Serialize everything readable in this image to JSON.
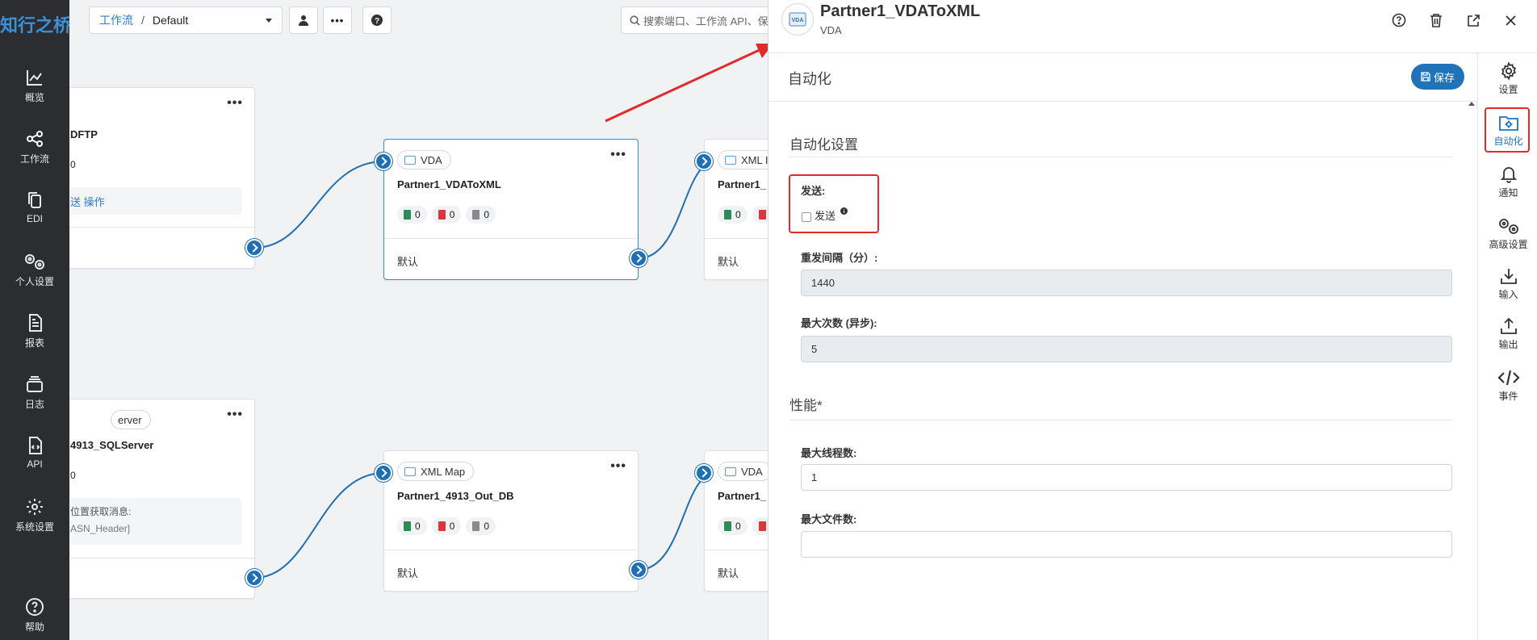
{
  "sidebar": {
    "logo": "知行之桥",
    "items": [
      {
        "label": "概览",
        "icon": "chart-icon"
      },
      {
        "label": "工作流",
        "icon": "flow-icon"
      },
      {
        "label": "EDI",
        "icon": "copy-icon"
      },
      {
        "label": "个人设置",
        "icon": "gears-icon"
      },
      {
        "label": "报表",
        "icon": "report-icon"
      },
      {
        "label": "日志",
        "icon": "layers-icon"
      },
      {
        "label": "API",
        "icon": "api-file-icon"
      },
      {
        "label": "系统设置",
        "icon": "gear-icon"
      }
    ],
    "help": "帮助"
  },
  "toolbar": {
    "breadcrumb_link": "工作流",
    "breadcrumb_sep": "/",
    "breadcrumb_current": "Default",
    "search_placeholder": "搜索端口、工作流 API、保"
  },
  "nodes": [
    {
      "tag": "",
      "title": "DFTP",
      "count": "0",
      "info": "送 操作",
      "footer": ""
    },
    {
      "tag": "VDA",
      "title": "Partner1_VDAToXML",
      "counts": [
        "0",
        "0",
        "0"
      ],
      "footer": "默认"
    },
    {
      "tag": "XML I",
      "title": "Partner1_",
      "counts": [
        "0"
      ],
      "footer": "默认"
    },
    {
      "tag": "erver",
      "title": "4913_SQLServer",
      "count": "0",
      "info1": "位置获取消息:",
      "info2": "ASN_Header]",
      "footer": ""
    },
    {
      "tag": "XML Map",
      "title": "Partner1_4913_Out_DB",
      "counts": [
        "0",
        "0",
        "0"
      ],
      "footer": "默认"
    },
    {
      "tag": "VDA",
      "title": "Partner1_",
      "counts": [
        "0"
      ],
      "footer": "默认"
    }
  ],
  "panel": {
    "avatar_text": "VDA",
    "title": "Partner1_VDAToXML",
    "subtitle": "VDA",
    "section_title": "自动化",
    "save_label": "保存",
    "automation_title": "自动化设置",
    "send_label": "发送:",
    "send_checkbox_label": "发送",
    "send_checked": false,
    "retry_label": "重发间隔（分）:",
    "retry_value": "1440",
    "max_attempts_label": "最大次数 (异步):",
    "max_attempts_value": "5",
    "performance_title": "性能*",
    "max_threads_label": "最大线程数:",
    "max_threads_value": "1",
    "max_files_label": "最大文件数:",
    "max_files_value": ""
  },
  "rightbar": [
    {
      "label": "设置",
      "icon": "gear-icon"
    },
    {
      "label": "自动化",
      "icon": "automation-folder-icon",
      "active": true
    },
    {
      "label": "通知",
      "icon": "bell-icon"
    },
    {
      "label": "高级设置",
      "icon": "gears-icon"
    },
    {
      "label": "输入",
      "icon": "download-icon"
    },
    {
      "label": "输出",
      "icon": "upload-icon"
    },
    {
      "label": "事件",
      "icon": "code-icon"
    }
  ],
  "colors": {
    "accent": "#2173b8",
    "annotation_red": "#e02b2b",
    "sidebar_bg": "#2b2d31"
  }
}
